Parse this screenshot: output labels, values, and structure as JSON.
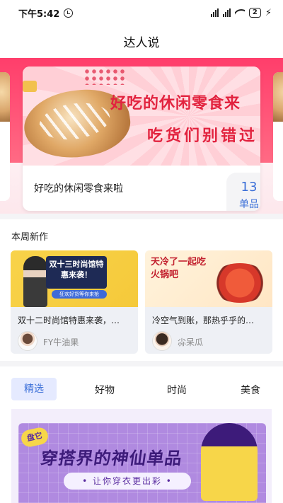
{
  "status": {
    "time": "下午5:42",
    "battery": "2"
  },
  "header": {
    "title": "达人说"
  },
  "banner": {
    "image_title": "好吃的休闲零食来",
    "image_subtitle": "吃货们别错过",
    "caption": "好吃的休闲零食来啦",
    "count": "13",
    "count_unit": "单品"
  },
  "weekly": {
    "title": "本周新作",
    "cards": [
      {
        "image_text": "双十三时尚馆特惠来袭！",
        "image_chip": "狂欢好货等你来抢",
        "caption": "双十二时尚馆特惠来袭，…",
        "author": "FY牛油果"
      },
      {
        "image_text": "天冷了一起吃火锅吧",
        "caption": "冷空气到账，那热乎乎的…",
        "author": "尛呆瓜"
      }
    ]
  },
  "tabs": [
    {
      "label": "精选",
      "active": true
    },
    {
      "label": "好物",
      "active": false
    },
    {
      "label": "时尚",
      "active": false
    },
    {
      "label": "美食",
      "active": false
    }
  ],
  "promo": {
    "tag": "盘它",
    "title": "穿搭界的神仙单品",
    "subtitle": "• 让你穿衣更出彩 •"
  },
  "colors": {
    "accent": "#3b6fd8",
    "banner_pink": "#ff4f74",
    "tab_active_bg": "#e5eaff"
  }
}
